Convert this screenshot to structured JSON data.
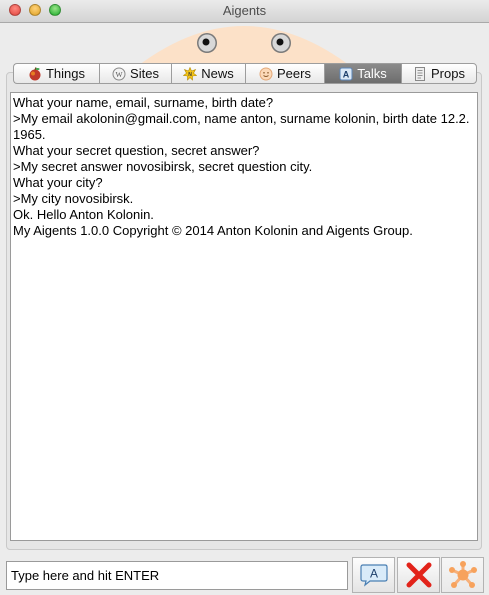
{
  "window": {
    "title": "Aigents"
  },
  "tabs": [
    {
      "label": "Things",
      "icon": "apple-icon"
    },
    {
      "label": "Sites",
      "icon": "w-globe-icon"
    },
    {
      "label": "News",
      "icon": "news-icon"
    },
    {
      "label": "Peers",
      "icon": "smiley-icon"
    },
    {
      "label": "Talks",
      "icon": "a-letter-icon",
      "active": true
    },
    {
      "label": "Props",
      "icon": "document-icon"
    }
  ],
  "conversation": [
    "What your name, email, surname, birth date?",
    ">My email akolonin@gmail.com, name anton, surname kolonin, birth date 12.2.1965.",
    "What your secret question, secret answer?",
    ">My secret answer novosibirsk, secret question city.",
    "What your city?",
    ">My city novosibirsk.",
    "Ok. Hello Anton Kolonin.",
    "My Aigents 1.0.0 Copyright © 2014 Anton Kolonin and Aigents Group."
  ],
  "input": {
    "placeholder": "Type here and hit ENTER"
  },
  "buttons": {
    "speak_letter": "A"
  },
  "colors": {
    "mascot": "#fce1c8",
    "close_x": "#e2231a",
    "settings": "#f7a25c",
    "tab_active": "#7b7b7b"
  }
}
